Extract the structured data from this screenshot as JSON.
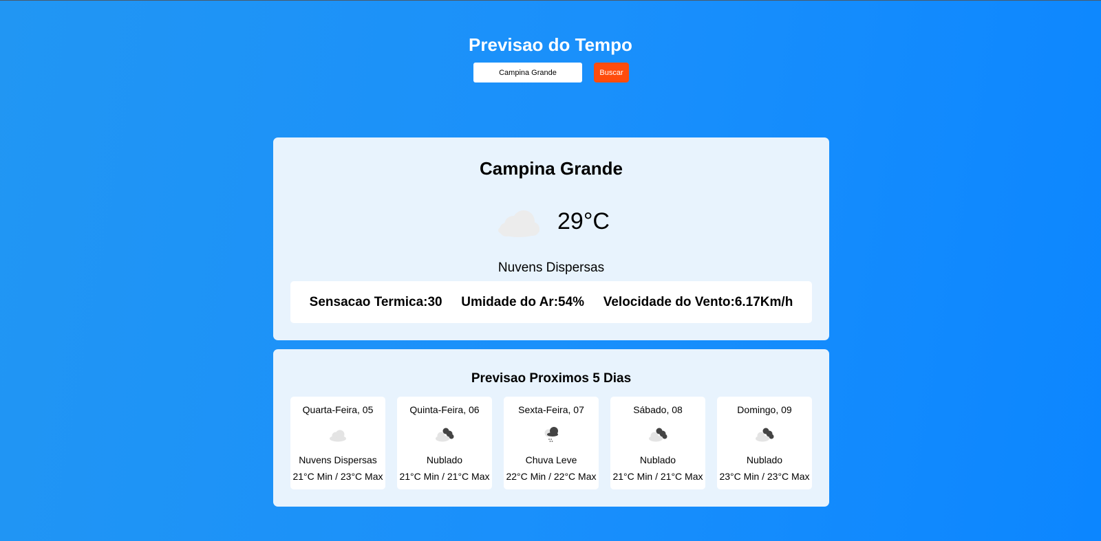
{
  "header": {
    "title": "Previsao do Tempo"
  },
  "search": {
    "value": "Campina Grande",
    "button_label": "Buscar"
  },
  "current": {
    "city": "Campina Grande",
    "icon": "scattered-clouds-icon",
    "temperature": "29°C",
    "condition": "Nuvens Dispersas",
    "feels_like": "Sensacao Termica:30",
    "humidity": "Umidade do Ar:54%",
    "wind": "Velocidade do Vento:6.17Km/h"
  },
  "forecast": {
    "title": "Previsao Proximos 5 Dias",
    "days": [
      {
        "day": "Quarta-Feira, 05",
        "icon": "scattered-clouds-icon",
        "condition": "Nuvens Dispersas",
        "temps": "21°C Min / 23°C Max"
      },
      {
        "day": "Quinta-Feira, 06",
        "icon": "broken-clouds-icon",
        "condition": "Nublado",
        "temps": "21°C Min / 21°C Max"
      },
      {
        "day": "Sexta-Feira, 07",
        "icon": "light-rain-icon",
        "condition": "Chuva Leve",
        "temps": "22°C Min / 22°C Max"
      },
      {
        "day": "Sábado, 08",
        "icon": "broken-clouds-icon",
        "condition": "Nublado",
        "temps": "21°C Min / 21°C Max"
      },
      {
        "day": "Domingo, 09",
        "icon": "broken-clouds-icon",
        "condition": "Nublado",
        "temps": "23°C Min / 23°C Max"
      }
    ]
  },
  "colors": {
    "background": "#1a90fb",
    "card": "#e8f3fd",
    "button": "#ff4c0c"
  }
}
